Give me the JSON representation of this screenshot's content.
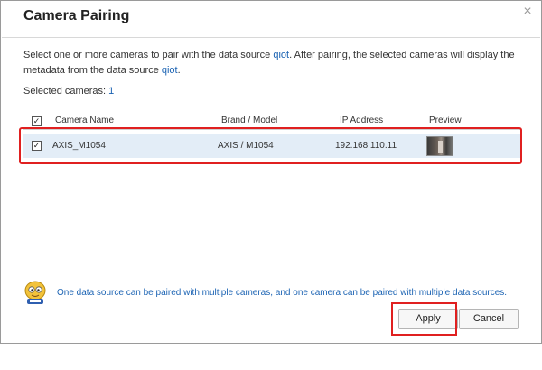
{
  "dialog": {
    "title": "Camera Pairing",
    "close_icon": "close-icon"
  },
  "description": {
    "part1": "Select one or more cameras to pair with the data source ",
    "source1": "qiot",
    "part2": ". After pairing, the selected cameras will display the metadata from the data source ",
    "source2": "qiot",
    "part3": "."
  },
  "selected": {
    "label": "Selected cameras: ",
    "count": "1"
  },
  "table": {
    "columns": [
      "Camera Name",
      "Brand / Model",
      "IP Address",
      "Preview"
    ],
    "header_checked": true,
    "rows": [
      {
        "checked": true,
        "camera_name": "AXIS_M1054",
        "brand_model": "AXIS / M1054",
        "ip_address": "192.168.110.11",
        "preview": "camera-preview-thumbnail"
      }
    ]
  },
  "hint": {
    "icon": "mascot-icon",
    "text": "One data source can be paired with multiple cameras, and one camera can be paired with multiple data sources."
  },
  "buttons": {
    "apply": "Apply",
    "cancel": "Cancel"
  },
  "colors": {
    "link": "#1b63b3",
    "row_selected": "#e3edf7",
    "highlight": "#e02020"
  }
}
